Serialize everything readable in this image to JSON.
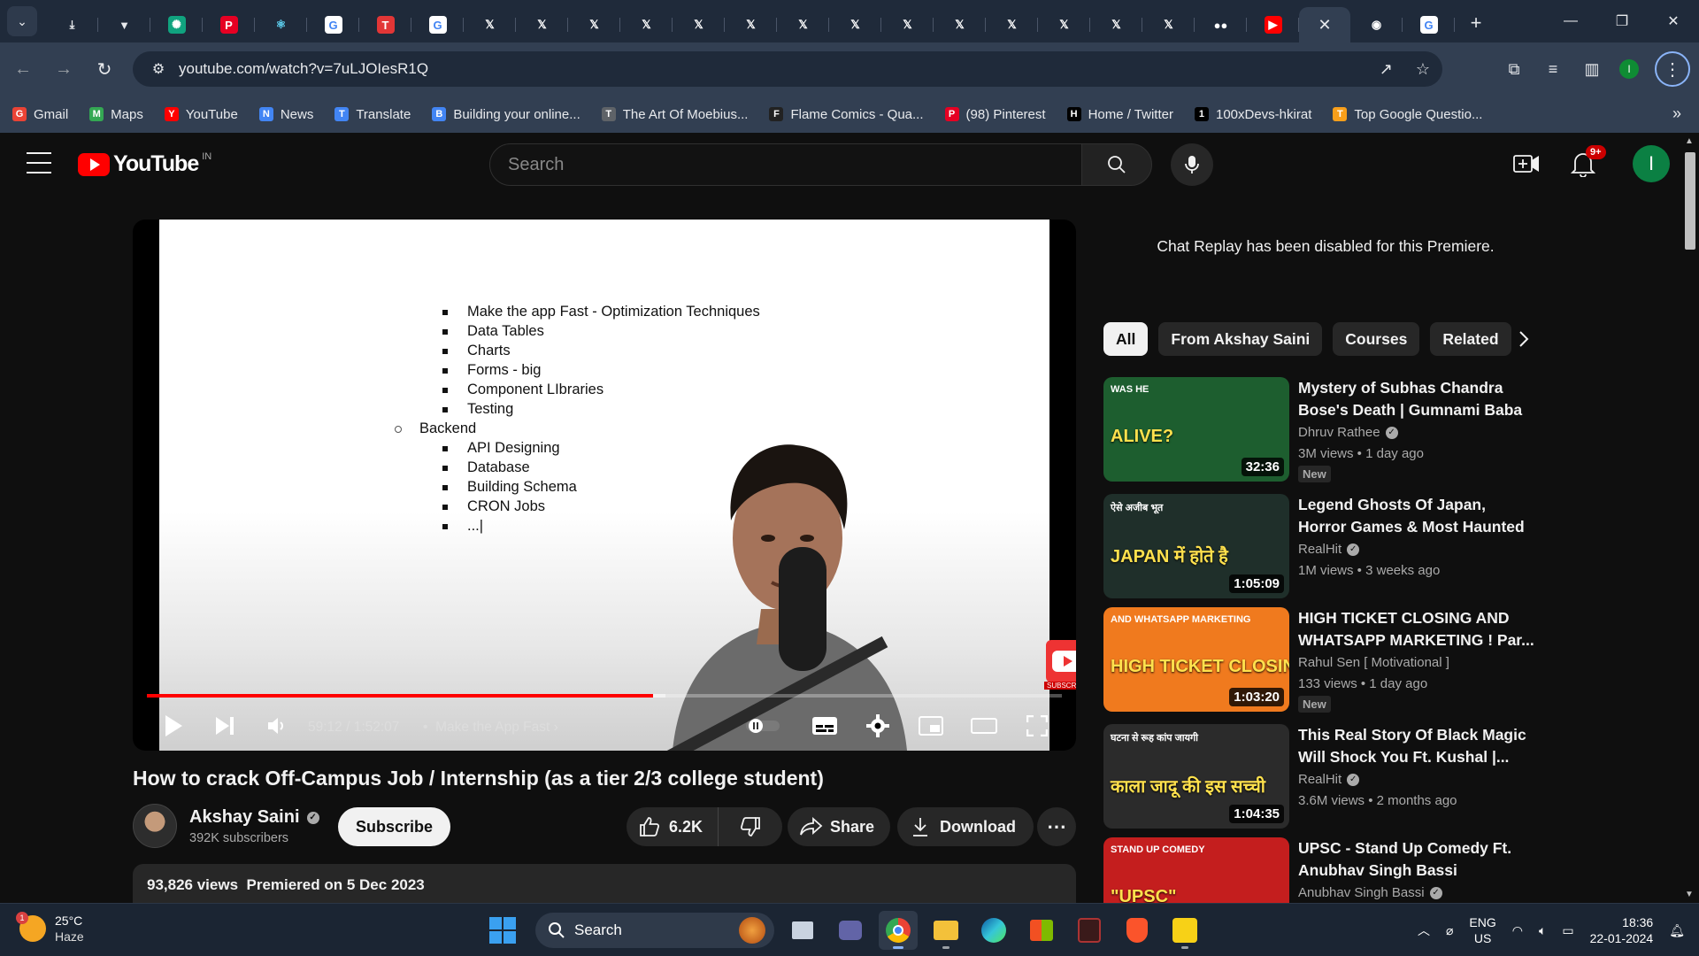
{
  "browser": {
    "tabs": [
      {
        "icon": "chevron-down-icon"
      },
      {
        "icon": "download-icon"
      },
      {
        "icon": "vercel-icon"
      },
      {
        "icon": "chatgpt-icon"
      },
      {
        "icon": "pinterest-icon"
      },
      {
        "icon": "react-icon"
      },
      {
        "icon": "google-icon"
      },
      {
        "icon": "t-icon"
      },
      {
        "icon": "google-icon"
      },
      {
        "icon": "x-icon"
      },
      {
        "icon": "x-icon"
      },
      {
        "icon": "x-icon"
      },
      {
        "icon": "x-icon"
      },
      {
        "icon": "x-icon"
      },
      {
        "icon": "x-icon"
      },
      {
        "icon": "x-icon"
      },
      {
        "icon": "x-icon"
      },
      {
        "icon": "x-icon"
      },
      {
        "icon": "x-icon"
      },
      {
        "icon": "x-icon"
      },
      {
        "icon": "x-icon"
      },
      {
        "icon": "x-icon"
      },
      {
        "icon": "x-icon"
      },
      {
        "icon": "medium-icon"
      },
      {
        "icon": "youtube-icon"
      },
      {
        "icon": "close-icon",
        "active": true
      },
      {
        "icon": "github-icon"
      },
      {
        "icon": "google-icon"
      }
    ],
    "url": "youtube.com/watch?v=7uLJOIesR1Q",
    "bookmarks": [
      {
        "label": "Gmail",
        "icon": "gmail-icon",
        "color": "#ea4335"
      },
      {
        "label": "Maps",
        "icon": "maps-icon",
        "color": "#34a853"
      },
      {
        "label": "YouTube",
        "icon": "youtube-icon",
        "color": "#ff0000"
      },
      {
        "label": "News",
        "icon": "news-icon",
        "color": "#4285f4"
      },
      {
        "label": "Translate",
        "icon": "translate-icon",
        "color": "#4285f4"
      },
      {
        "label": "Building your online...",
        "icon": "google-icon",
        "color": "#4285f4"
      },
      {
        "label": "The Art Of Moebius...",
        "icon": "globe-icon",
        "color": "#5f6368"
      },
      {
        "label": "Flame Comics - Qua...",
        "icon": "info-icon",
        "color": "#222222"
      },
      {
        "label": "(98) Pinterest",
        "icon": "pinterest-icon",
        "color": "#e60023"
      },
      {
        "label": "Home / Twitter",
        "icon": "x-icon",
        "color": "#000000"
      },
      {
        "label": "100xDevs-hkirat",
        "icon": "github-icon",
        "color": "#000000"
      },
      {
        "label": "Top Google Questio...",
        "icon": "leetcode-icon",
        "color": "#f89f1b"
      }
    ]
  },
  "youtube": {
    "logo_text": "YouTube",
    "country_code": "IN",
    "search_placeholder": "Search",
    "notification_count": "9+",
    "avatar_letter": "I",
    "profile_letter": "I"
  },
  "player": {
    "slide_items": [
      {
        "text": "Make the app Fast - Optimization Techniques",
        "level": 2
      },
      {
        "text": "Data Tables",
        "level": 2
      },
      {
        "text": "Charts",
        "level": 2
      },
      {
        "text": "Forms - big",
        "level": 2
      },
      {
        "text": "Component LIbraries",
        "level": 2
      },
      {
        "text": "Testing",
        "level": 2
      },
      {
        "text": "Backend",
        "level": 1
      },
      {
        "text": "API Designing",
        "level": 2
      },
      {
        "text": "Database",
        "level": 2
      },
      {
        "text": "Building Schema",
        "level": 2
      },
      {
        "text": "CRON Jobs",
        "level": 2
      },
      {
        "text": "...|",
        "level": 2
      }
    ],
    "watermark_label": "SUBSCRIBE",
    "played_fraction": 0.553,
    "loaded_fraction": 0.567,
    "timecode": "59:12 / 1:52:07",
    "chapter_separator": "•",
    "chapter": "Make the App Fast"
  },
  "video": {
    "title": "How to crack Off-Campus Job / Internship (as a tier 2/3 college student)",
    "channel_name": "Akshay Saini",
    "subscribers": "392K subscribers",
    "subscribe_label": "Subscribe",
    "likes": "6.2K",
    "share_label": "Share",
    "download_label": "Download",
    "views": "93,826 views",
    "premiered": "Premiered on 5 Dec 2023"
  },
  "sidebar": {
    "chat_replay_text": "Chat Replay has been disabled for this Premiere.",
    "chips": [
      "All",
      "From Akshay Saini",
      "Courses",
      "Related"
    ],
    "recommendations": [
      {
        "title": "Mystery of Subhas Chandra Bose's Death | Gumnami Baba ...",
        "channel": "Dhruv Rathee",
        "meta": "3M views • 1 day ago",
        "duration": "32:36",
        "badge": "New",
        "thumb_text": "ALIVE?",
        "thumb_sub": "WAS HE",
        "thumb_bg": "#1d5e2f"
      },
      {
        "title": "Legend Ghosts Of Japan, Horror Games & Most Haunted Villag...",
        "channel": "RealHit",
        "meta": "1M views • 3 weeks ago",
        "duration": "1:05:09",
        "badge": "",
        "thumb_text": "JAPAN में होते है",
        "thumb_sub": "ऐसे अजीब भूत",
        "thumb_bg": "#1f2f2a"
      },
      {
        "title": "HIGH TICKET CLOSING AND WHATSAPP MARKETING ! Par...",
        "channel": "Rahul Sen [ Motivational ]",
        "meta": "133 views • 1 day ago",
        "duration": "1:03:20",
        "badge": "New",
        "thumb_text": "HIGH TICKET CLOSING",
        "thumb_sub": "AND WHATSAPP MARKETING",
        "thumb_bg": "#f07a1e"
      },
      {
        "title": "This Real Story Of Black Magic Will Shock You Ft. Kushal |...",
        "channel": "RealHit",
        "meta": "3.6M views • 2 months ago",
        "duration": "1:04:35",
        "badge": "",
        "thumb_text": "काला जादू की इस सच्ची",
        "thumb_sub": "घटना से रूह कांप जायगी",
        "thumb_bg": "#2b2b2b"
      },
      {
        "title": "UPSC - Stand Up Comedy Ft. Anubhav Singh Bassi",
        "channel": "Anubhav Singh Bassi",
        "meta": "",
        "duration": "",
        "badge": "",
        "thumb_text": "\"UPSC\"",
        "thumb_sub": "STAND UP COMEDY",
        "thumb_bg": "#c41e1e"
      }
    ]
  },
  "taskbar": {
    "weather_temp": "25°C",
    "weather_cond": "Haze",
    "weather_notif": "1",
    "search_label": "Search",
    "lang_top": "ENG",
    "lang_bottom": "US",
    "time": "18:36",
    "date": "22-01-2024"
  }
}
